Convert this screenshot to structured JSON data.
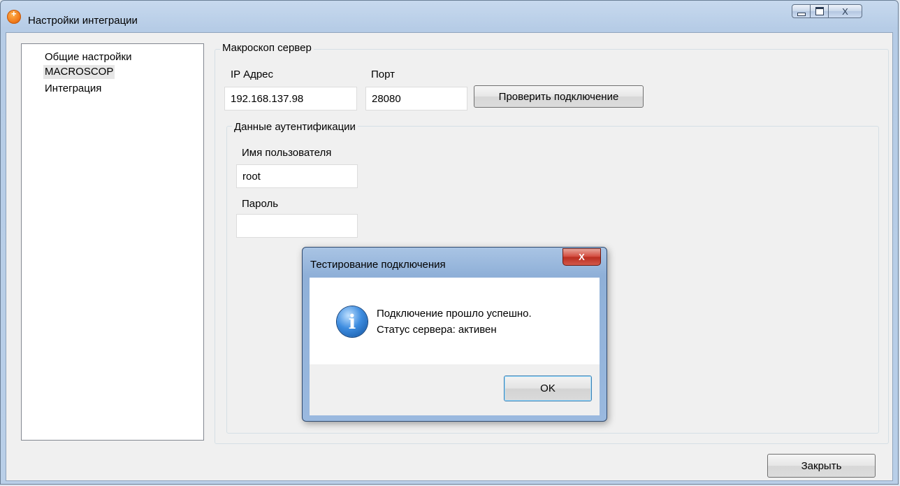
{
  "window": {
    "title": "Настройки интеграции",
    "icon": "orange-plus-icon",
    "maximize_glyph": "max-glyph",
    "close_glyph": "X"
  },
  "nav_tree": {
    "items": [
      {
        "label": "Общие настройки"
      },
      {
        "label": "MACROSCOP",
        "selected": true
      },
      {
        "label": "Интеграция"
      }
    ]
  },
  "server_group": {
    "title": "Макроскоп сервер",
    "ip_label": "IP Адрес",
    "ip_value": "192.168.137.98",
    "port_label": "Порт",
    "port_value": "28080",
    "test_button": "Проверить подключение"
  },
  "auth_group": {
    "title": "Данные аутентификации",
    "username_label": "Имя пользователя",
    "username_value": "root",
    "password_label": "Пароль",
    "password_value": ""
  },
  "dialog": {
    "title": "Тестирование подключения",
    "close_glyph": "X",
    "icon": "info-icon",
    "message_line1": "Подключение прошло успешно.",
    "message_line2": "Статус сервера: активен",
    "ok_button": "OK"
  },
  "footer": {
    "close_button": "Закрыть"
  }
}
